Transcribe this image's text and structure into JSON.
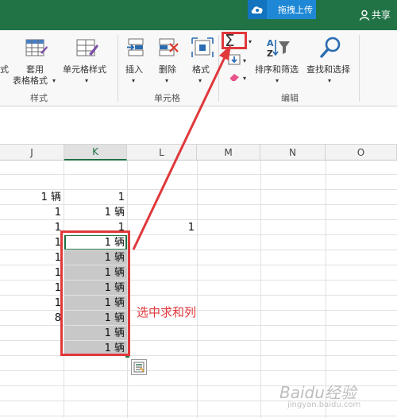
{
  "titlebar": {
    "upload_label": "拖拽上传",
    "share_label": "共享"
  },
  "ribbon": {
    "style_partial": "式",
    "table_format_line1": "套用",
    "table_format_line2": "表格格式",
    "cell_style_label": "单元格样式",
    "insert_label": "插入",
    "delete_label": "删除",
    "format_label": "格式",
    "sort_filter_label": "排序和筛选",
    "find_select_label": "查找和选择",
    "group_styles": "样式",
    "group_cells": "单元格",
    "group_editing": "编辑",
    "autosum_symbol": "Σ"
  },
  "columns": [
    "J",
    "K",
    "L",
    "M",
    "N",
    "O"
  ],
  "selected_column": "K",
  "cells": {
    "r1": {
      "J": "1 辆",
      "K": "1"
    },
    "r2": {
      "J": "1",
      "K": "1 辆"
    },
    "r3": {
      "J": "1",
      "K": "1",
      "L": "1"
    },
    "r4": {
      "J": "1",
      "K": "1 辆"
    },
    "r5": {
      "J": "1",
      "K": "1 辆"
    },
    "r6": {
      "J": "1",
      "K": "1 辆"
    },
    "r7": {
      "J": "1",
      "K": "1 辆"
    },
    "r8": {
      "J": "1",
      "K": "1 辆"
    },
    "r9": {
      "J": "8",
      "K": "1 辆"
    },
    "r10": {
      "K": "1 辆"
    },
    "r11": {
      "K": "1 辆"
    }
  },
  "annotation": "选中求和列",
  "watermark": {
    "main": "Baidu经验",
    "sub": "jingyan.baidu.com"
  },
  "colors": {
    "excel_green": "#217346",
    "accent_red": "#e0383b",
    "upload_blue": "#1e88d6"
  }
}
